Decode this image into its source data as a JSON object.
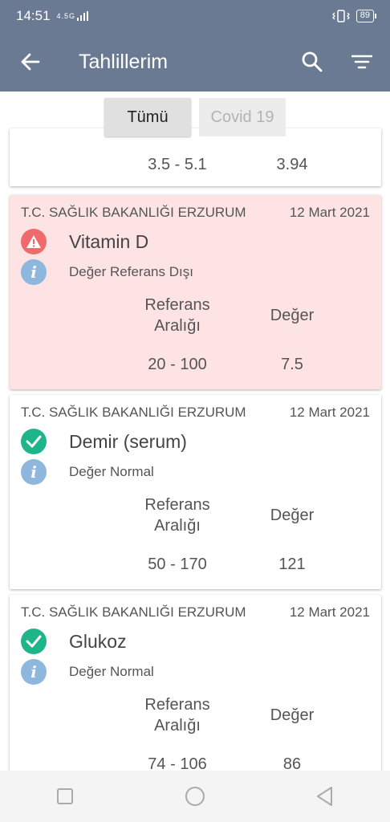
{
  "status_bar": {
    "time": "14:51",
    "network": "4.5G",
    "battery": "89"
  },
  "header": {
    "title": "Tahlillerim",
    "back_icon": "arrow-left-icon",
    "search_icon": "search-icon",
    "filter_icon": "filter-icon"
  },
  "tabs": [
    {
      "label": "Tümü",
      "active": true
    },
    {
      "label": "Covid 19",
      "active": false
    }
  ],
  "partial_card": {
    "reference": "3.5 - 5.1",
    "value": "3.94"
  },
  "column_headers": {
    "reference": "Referans Aralığı",
    "value": "Değer"
  },
  "results": [
    {
      "institution": "T.C. SAĞLIK BAKANLIĞI ERZURUM",
      "date": "12 Mart 2021",
      "name": "Vitamin D",
      "status": "Değer Referans Dışı",
      "status_type": "warning",
      "reference": "20 - 100",
      "value": "7.5",
      "highlight_color": "#fde3e3"
    },
    {
      "institution": "T.C. SAĞLIK BAKANLIĞI ERZURUM",
      "date": "12 Mart 2021",
      "name": "Demir (serum)",
      "status": "Değer Normal",
      "status_type": "ok",
      "reference": "50 - 170",
      "value": "121"
    },
    {
      "institution": "T.C. SAĞLIK BAKANLIĞI ERZURUM",
      "date": "12 Mart 2021",
      "name": "Glukoz",
      "status": "Değer Normal",
      "status_type": "ok",
      "reference": "74 - 106",
      "value": "86"
    }
  ],
  "nav": {
    "recent_icon": "square-icon",
    "home_icon": "circle-icon",
    "back_icon": "triangle-back-icon"
  },
  "colors": {
    "appbar": "#6b7a93",
    "ok": "#1fb58a",
    "warning": "#ef6a6a",
    "info": "#8db7dc"
  }
}
